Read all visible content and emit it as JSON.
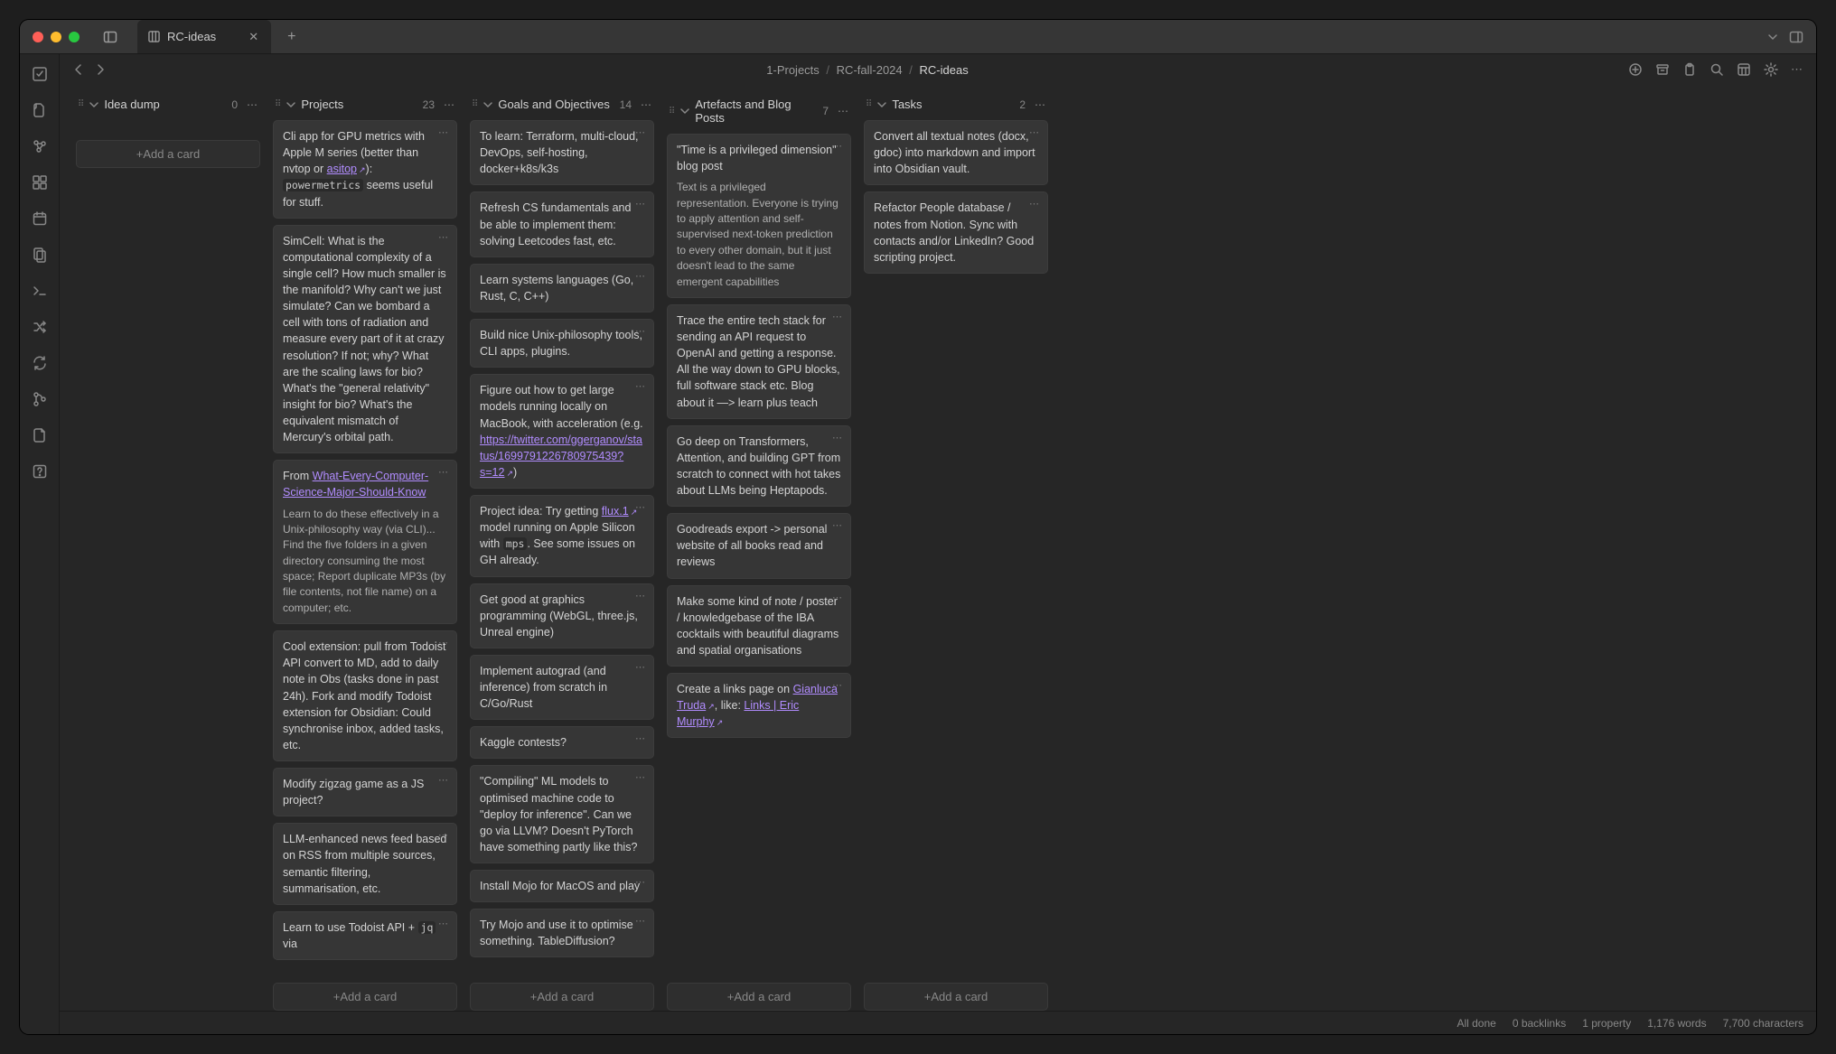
{
  "tab_title": "RC-ideas",
  "breadcrumbs": [
    "1-Projects",
    "RC-fall-2024",
    "RC-ideas"
  ],
  "add_card_label": "+Add a card",
  "status": {
    "all_done": "All done",
    "backlinks": "0 backlinks",
    "properties": "1 property",
    "words": "1,176 words",
    "chars": "7,700 characters"
  },
  "lanes": [
    {
      "title": "Idea dump",
      "count": "0",
      "cards": []
    },
    {
      "title": "Projects",
      "count": "23",
      "cards": [
        {
          "html": "Cli app for GPU metrics with Apple M series (better than nvtop or <a href='#'>asitop</a><span class='ext'>↗</span>): <code>powermetrics</code> seems useful for stuff."
        },
        {
          "html": "SimCell: What is the computational complexity of a single cell? How much smaller is the manifold? Why can't we just simulate? Can we bombard a cell with tons of radiation and measure every part of it at crazy resolution? If not; why? What are the scaling laws for bio? What's the \"general relativity\" insight for bio? What's the equivalent mismatch of Mercury's orbital path."
        },
        {
          "html": "From <a href='#'>What-Every-Computer-Science-Major-Should-Know</a><div class='card-subtext'>Learn to do these effectively in a Unix-philosophy way (via CLI)... Find the five folders in a given directory consuming the most space; Report duplicate MP3s (by file contents, not file name) on a computer; etc.</div>"
        },
        {
          "html": "Cool extension: pull from Todoist API convert to MD, add to daily note in Obs (tasks done in past 24h). Fork and modify Todoist extension for Obsidian: Could synchronise inbox, added tasks, etc."
        },
        {
          "html": "Modify zigzag game as a JS project?"
        },
        {
          "html": "LLM-enhanced news feed based on RSS from multiple sources, semantic filtering, summarisation, etc."
        },
        {
          "html": "Learn to use Todoist API + <code>jq</code> via"
        }
      ]
    },
    {
      "title": "Goals and Objectives",
      "count": "14",
      "cards": [
        {
          "html": "To learn: Terraform, multi-cloud, DevOps, self-hosting, docker+k8s/k3s"
        },
        {
          "html": "Refresh CS fundamentals and be able to implement them: solving Leetcodes fast, etc."
        },
        {
          "html": "Learn systems languages (Go, Rust, C, C++)"
        },
        {
          "html": "Build nice Unix-philosophy tools, CLI apps, plugins."
        },
        {
          "html": "Figure out how to get large models running locally on MacBook, with acceleration (e.g. <a href='#'>https://twitter.com/ggerganov/status/1699791226780975439?s=12</a><span class='ext'>↗</span>)"
        },
        {
          "html": "Project idea: Try getting <a href='#'>flux.1</a><span class='ext'>↗</span> model running on Apple Silicon with <code>mps</code>. See some issues on GH already."
        },
        {
          "html": "Get good at graphics programming (WebGL, three.js, Unreal engine)"
        },
        {
          "html": "Implement autograd (and inference) from scratch in C/Go/Rust"
        },
        {
          "html": "Kaggle contests?"
        },
        {
          "html": "\"Compiling\" ML models to optimised machine code to \"deploy for inference\". Can we go via LLVM? Doesn't PyTorch have something partly like this?"
        },
        {
          "html": "Install Mojo for MacOS and play"
        },
        {
          "html": "Try Mojo and use it to optimise something. TableDiffusion?"
        }
      ]
    },
    {
      "title": "Artefacts and Blog Posts",
      "count": "7",
      "cards": [
        {
          "html": "\"Time is a privileged dimension\" blog post<div class='card-subtext'>Text is a privileged representation. Everyone is trying to apply attention and self-supervised next-token prediction to every other domain, but it just doesn't lead to the same emergent capabilities</div>"
        },
        {
          "html": "Trace the entire tech stack for sending an API request to OpenAI and getting a response. All the way down to GPU blocks, full software stack etc. Blog about it —> learn plus teach"
        },
        {
          "html": "Go deep on Transformers, Attention, and building GPT from scratch to connect with hot takes about LLMs being Heptapods."
        },
        {
          "html": "Goodreads export -> personal website of all books read and reviews"
        },
        {
          "html": "Make some kind of note / poster / knowledgebase of the IBA cocktails with beautiful diagrams and spatial organisations"
        },
        {
          "html": "Create a links page on <a href='#'>Gianluca Truda</a><span class='ext'>↗</span>, like: <a href='#'>Links | Eric Murphy</a><span class='ext'>↗</span>"
        }
      ]
    },
    {
      "title": "Tasks",
      "count": "2",
      "cards": [
        {
          "html": "Convert all textual notes (docx, gdoc) into markdown and import into Obsidian vault."
        },
        {
          "html": "Refactor People database / notes from Notion. Sync with contacts and/or LinkedIn? Good scripting project."
        }
      ]
    }
  ]
}
